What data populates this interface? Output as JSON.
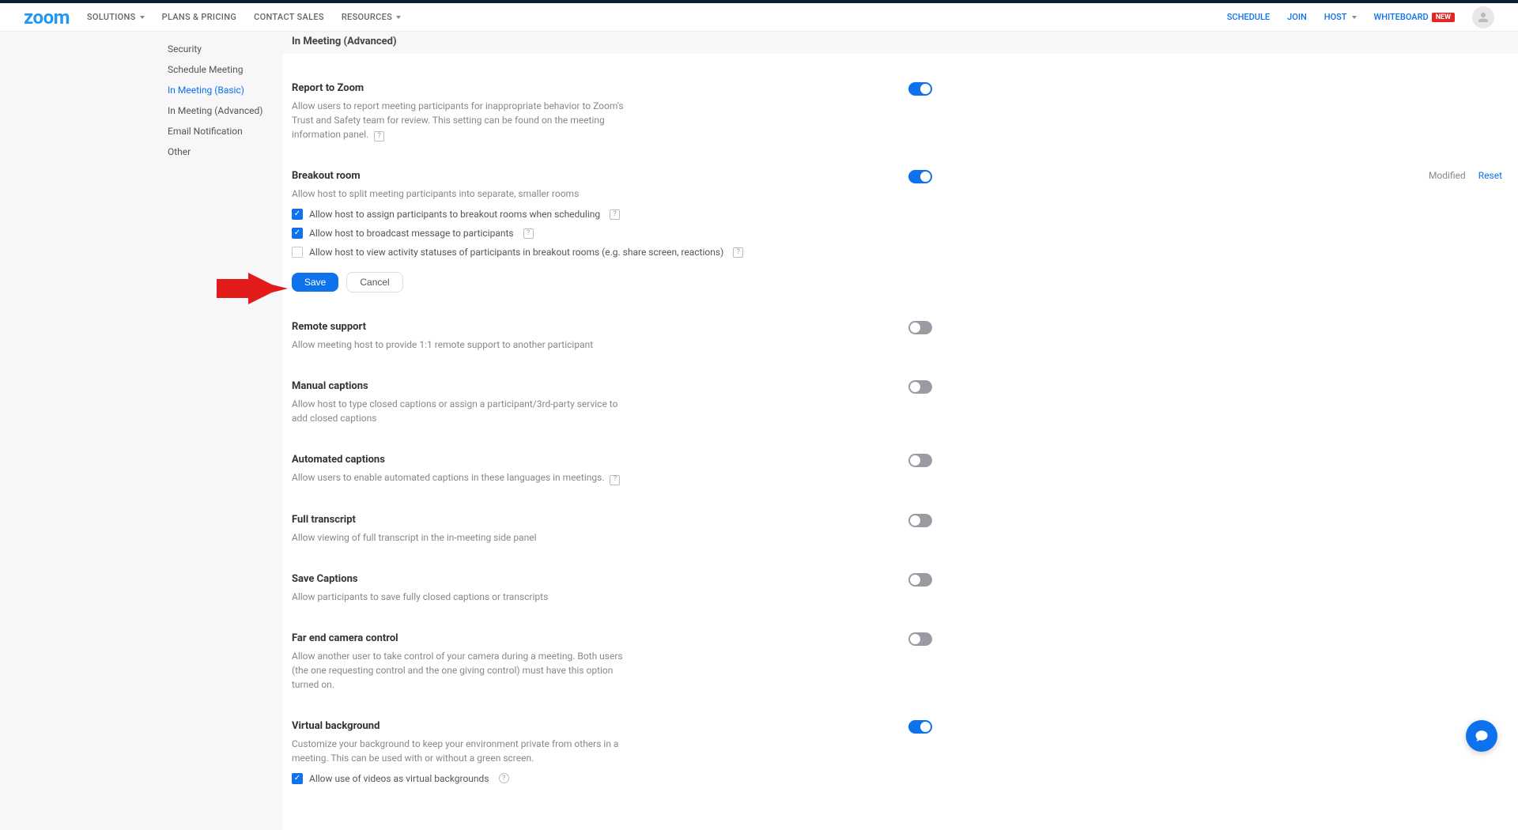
{
  "header": {
    "logo": "zoom",
    "nav": {
      "solutions": "SOLUTIONS",
      "plans": "PLANS & PRICING",
      "contact": "CONTACT SALES",
      "resources": "RESOURCES"
    },
    "right": {
      "schedule": "SCHEDULE",
      "join": "JOIN",
      "host": "HOST",
      "whiteboard": "WHITEBOARD",
      "new_badge": "NEW"
    }
  },
  "sidenav": {
    "security": "Security",
    "schedule": "Schedule Meeting",
    "basic": "In Meeting (Basic)",
    "advanced": "In Meeting (Advanced)",
    "email": "Email Notification",
    "other": "Other"
  },
  "section_title": "In Meeting (Advanced)",
  "breakout": {
    "title": "Breakout room",
    "desc": "Allow host to split meeting participants into separate, smaller rooms",
    "opt1": "Allow host to assign participants to breakout rooms when scheduling",
    "opt2": "Allow host to broadcast message to participants",
    "opt3": "Allow host to view activity statuses of participants in breakout rooms (e.g. share screen, reactions)",
    "modified": "Modified",
    "reset": "Reset"
  },
  "report": {
    "title": "Report to Zoom",
    "desc": "Allow users to report meeting participants for inappropriate behavior to Zoom's Trust and Safety team for review. This setting can be found on the meeting information panel."
  },
  "remote": {
    "title": "Remote support",
    "desc": "Allow meeting host to provide 1:1 remote support to another participant"
  },
  "manual_captions": {
    "title": "Manual captions",
    "desc": "Allow host to type closed captions or assign a participant/3rd-party service to add closed captions"
  },
  "auto_captions": {
    "title": "Automated captions",
    "desc": "Allow users to enable automated captions in these languages in meetings."
  },
  "full_transcript": {
    "title": "Full transcript",
    "desc": "Allow viewing of full transcript in the in-meeting side panel"
  },
  "save_captions": {
    "title": "Save Captions",
    "desc": "Allow participants to save fully closed captions or transcripts"
  },
  "far_end": {
    "title": "Far end camera control",
    "desc": "Allow another user to take control of your camera during a meeting. Both users (the one requesting control and the one giving control) must have this option turned on."
  },
  "virtual_bg": {
    "title": "Virtual background",
    "desc": "Customize your background to keep your environment private from others in a meeting. This can be used with or without a green screen.",
    "opt1": "Allow use of videos as virtual backgrounds"
  },
  "buttons": {
    "save": "Save",
    "cancel": "Cancel"
  }
}
